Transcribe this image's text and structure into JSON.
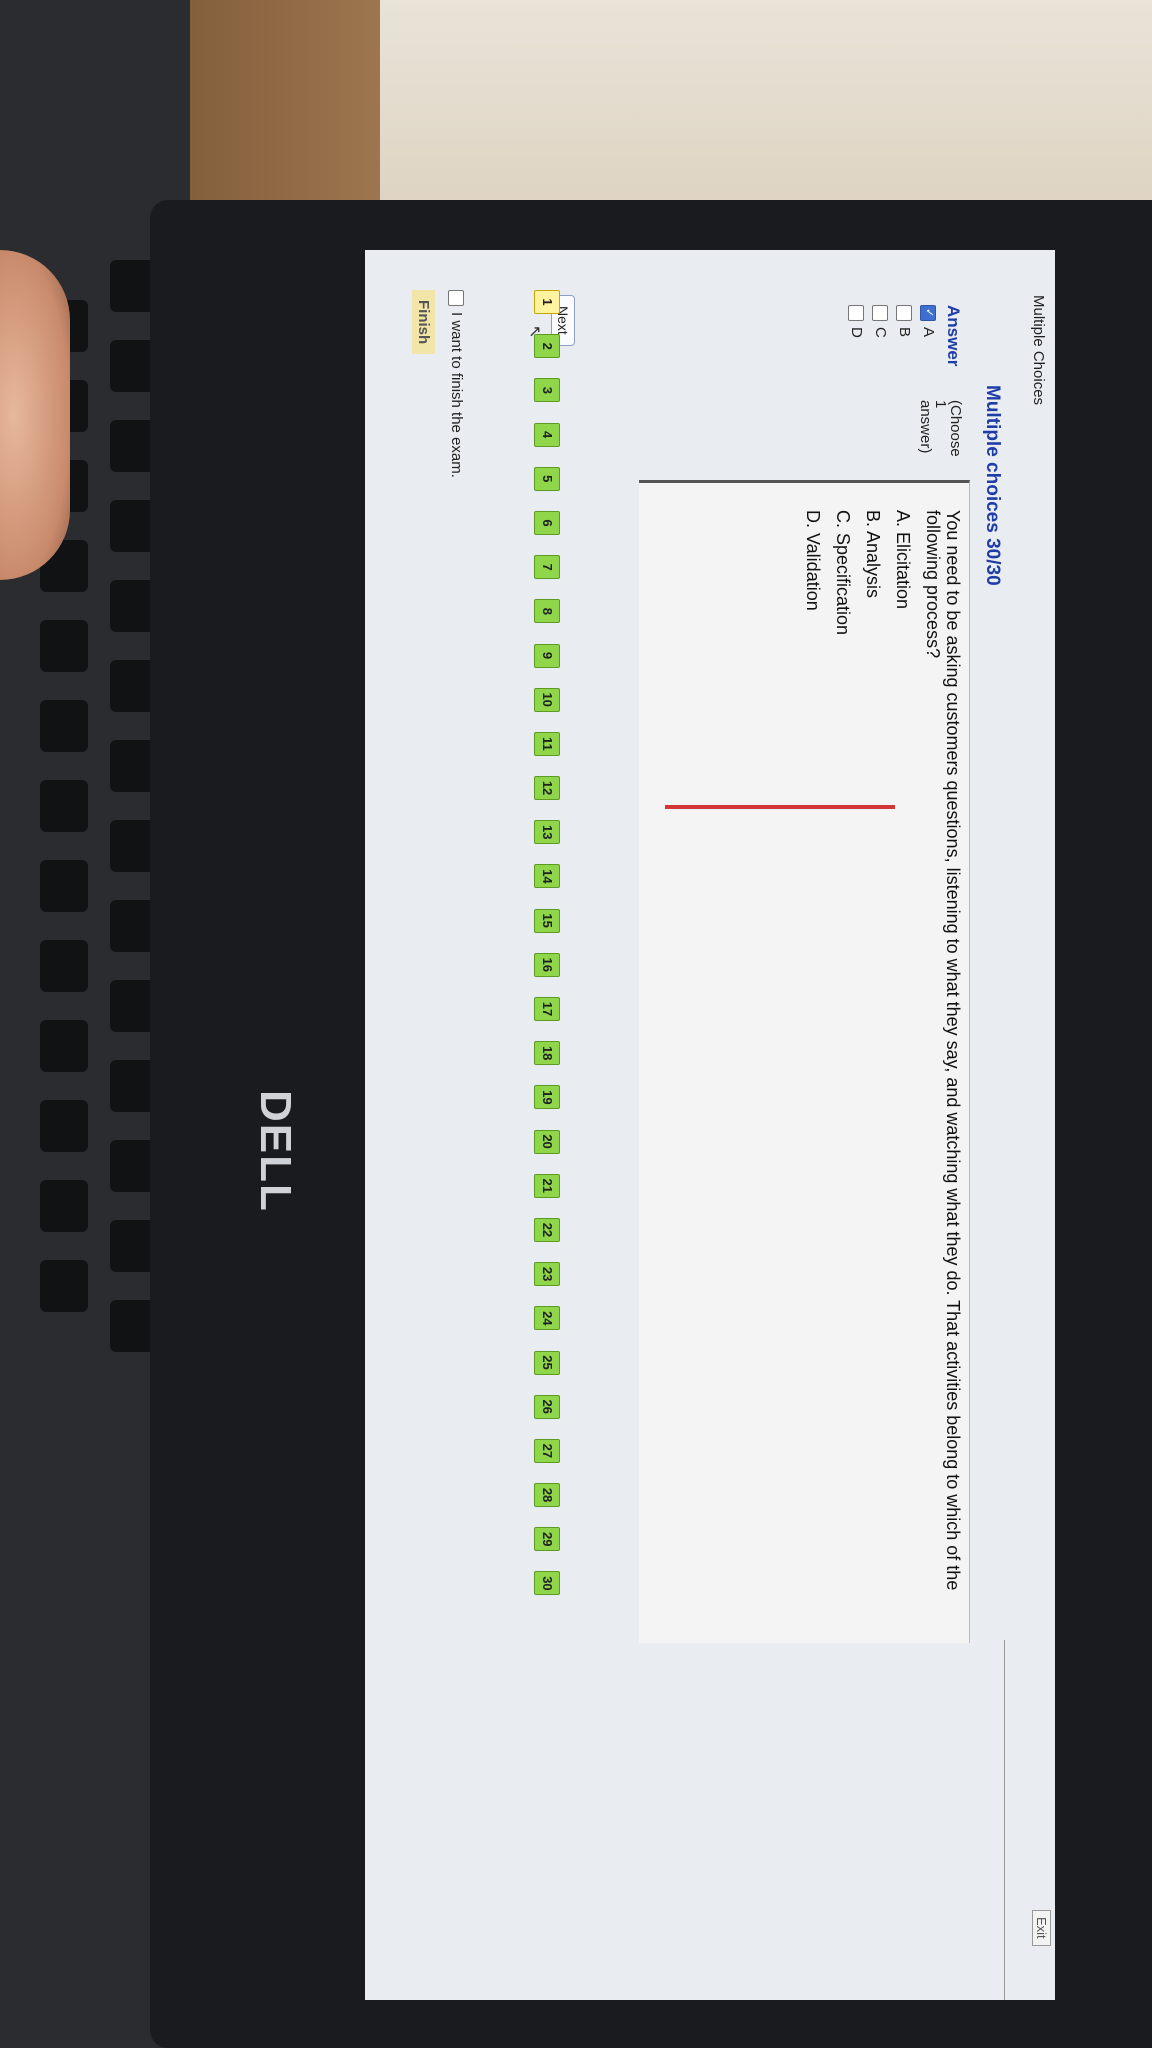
{
  "app": {
    "title": "Multiple Choices",
    "exit_label": "Exit"
  },
  "question": {
    "heading": "Multiple choices 30/30",
    "answer_label": "Answer",
    "choose_hint": "(Choose 1 answer)",
    "text": "You need to be asking customers questions, listening to what they say, and watching what they do. That activities belong to which of the following process?",
    "choices": [
      "A. Elicitation",
      "B. Analysis",
      "C. Specification",
      "D. Validation"
    ]
  },
  "answer_options": [
    {
      "label": "A",
      "checked": true
    },
    {
      "label": "B",
      "checked": false
    },
    {
      "label": "C",
      "checked": false
    },
    {
      "label": "D",
      "checked": false
    }
  ],
  "navigation": {
    "next_label": "Next",
    "question_numbers": [
      "1",
      "2",
      "3",
      "4",
      "5",
      "6",
      "7",
      "8",
      "9",
      "10",
      "11",
      "12",
      "13",
      "14",
      "15",
      "16",
      "17",
      "18",
      "19",
      "20",
      "21",
      "22",
      "23",
      "24",
      "25",
      "26",
      "27",
      "28",
      "29",
      "30"
    ],
    "current": "1"
  },
  "finish": {
    "checkbox_label": "I want to finish the exam.",
    "button_label": "Finish"
  },
  "laptop": {
    "brand": "DELL"
  },
  "colors": {
    "answered": "#8fd64a",
    "heading": "#1f3da8",
    "accent_red": "#d23636"
  }
}
